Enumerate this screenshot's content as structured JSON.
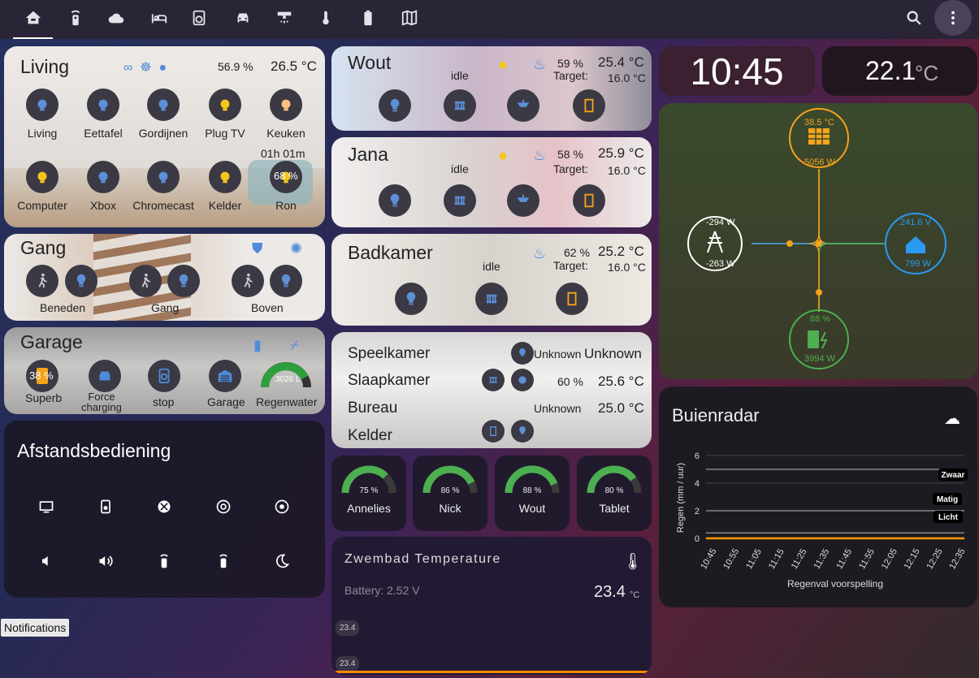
{
  "colors": {
    "accent_blue": "#4f8bdb",
    "solar": "#f5a31b",
    "grid": "#ffffff",
    "home": "#2b9af3",
    "battery": "#4caf50",
    "gauge": "#4caf50",
    "flame": "#4f8bdb",
    "rain_line": "#ff9800"
  },
  "topbar": {
    "icons": [
      "home-icon",
      "remote-icon",
      "cloud-icon",
      "bed-icon",
      "washer-icon",
      "car-icon",
      "shower-icon",
      "thermometer-icon",
      "battery-icon",
      "map-icon"
    ],
    "search_icon": "search-icon",
    "menu_icon": "dots-vertical-icon"
  },
  "living": {
    "title": "Living",
    "humidity": "56.9 %",
    "temp": "26.5 °C",
    "timer": "01h 01m",
    "fan_pct": "68 %",
    "buttons": [
      {
        "label": "Living",
        "icon": "bulb-icon"
      },
      {
        "label": "Eettafel",
        "icon": "bulb-icon"
      },
      {
        "label": "Gordijnen",
        "icon": "curtains-icon"
      },
      {
        "label": "Plug TV",
        "icon": "socket-icon"
      },
      {
        "label": "Keuken",
        "icon": "bulb-icon"
      },
      {
        "label": "Computer",
        "icon": "desktop-icon"
      },
      {
        "label": "Xbox",
        "icon": "xbox-icon"
      },
      {
        "label": "Chromecast",
        "icon": "cast-icon"
      },
      {
        "label": "Kelder",
        "icon": "fan-icon"
      },
      {
        "label": "Ron",
        "icon": "washer-icon"
      }
    ]
  },
  "gang": {
    "title": "Gang",
    "buttons": [
      {
        "label": "Beneden"
      },
      {
        "label": "Gang"
      },
      {
        "label": "Boven"
      }
    ]
  },
  "garage": {
    "title": "Garage",
    "superb_pct": "38 %",
    "rain_tank": "3026 L",
    "buttons": [
      {
        "label": "Superb"
      },
      {
        "label": "Force\ncharging"
      },
      {
        "label": "stop"
      },
      {
        "label": "Garage"
      },
      {
        "label": "Regenwater"
      }
    ]
  },
  "remote": {
    "title": "Afstandsbediening",
    "row1": [
      "tv-icon",
      "speaker-icon",
      "xbox-icon",
      "chrome-icon",
      "record-icon"
    ],
    "row2": [
      "volume-down-icon",
      "volume-up-icon",
      "remote-icon",
      "remote-icon",
      "sleep-icon"
    ]
  },
  "notifications": {
    "label": "Notifications"
  },
  "wout": {
    "title": "Wout",
    "state": "idle",
    "humidity": "59 %",
    "temp": "25.4 °C",
    "target_label": "Target:",
    "target": "16.0 °C"
  },
  "jana": {
    "title": "Jana",
    "state": "idle",
    "humidity": "58 %",
    "temp": "25.9 °C",
    "target_label": "Target:",
    "target": "16.0 °C"
  },
  "badkamer": {
    "title": "Badkamer",
    "state": "idle",
    "humidity": "62 %",
    "temp": "25.2 °C",
    "target_label": "Target:",
    "target": "16.0 °C"
  },
  "rooms": {
    "rows": [
      {
        "name": "Speelkamer",
        "hum": "Unknown",
        "temp": "Unknown"
      },
      {
        "name": "Slaapkamer",
        "hum": "60 %",
        "temp": "25.6 °C"
      },
      {
        "name": "Bureau",
        "hum": "Unknown",
        "temp": "25.0 °C"
      },
      {
        "name": "Kelder",
        "hum": "",
        "temp": ""
      }
    ]
  },
  "gauges": [
    {
      "label": "Annelies",
      "value": "75 %",
      "level": 0.75
    },
    {
      "label": "Nick",
      "value": "86 %",
      "level": 0.86
    },
    {
      "label": "Wout",
      "value": "88 %",
      "level": 0.88
    },
    {
      "label": "Tablet",
      "value": "80 %",
      "level": 0.8
    }
  ],
  "pool": {
    "title": "Zwembad Temperature",
    "battery": "Battery: 2.52 V",
    "temp": "23.4",
    "unit": "°C",
    "chip1": "23.4",
    "chip2": "23.4"
  },
  "clock": {
    "time": "10:45",
    "temp": "22.1",
    "unit": "°C"
  },
  "energy": {
    "solar_temp": "38.5 °C",
    "solar_w": "5056 W",
    "grid_in": "-294 W",
    "grid_out": "-263 W",
    "home_v": "241.6 V",
    "home_w": "799 W",
    "battery_pct": "88 %",
    "battery_w": "3994 W"
  },
  "buienradar": {
    "title": "Buienradar",
    "ylabel": "Regen (mm / uur)",
    "xlabel": "Regenval voorspelling",
    "levels": [
      "Zwaar",
      "Matig",
      "Licht"
    ]
  },
  "chart_data": {
    "type": "line",
    "x": [
      "10:45",
      "10:55",
      "11:05",
      "11:15",
      "11:25",
      "11:35",
      "11:45",
      "11:55",
      "12:05",
      "12:15",
      "12:25",
      "12:35"
    ],
    "series": [
      {
        "values": [
          0,
          0,
          0,
          0,
          0,
          0,
          0,
          0,
          0,
          0,
          0,
          0
        ]
      }
    ],
    "ylim": [
      0,
      6
    ],
    "yticks": [
      0,
      2,
      4,
      6
    ],
    "thresholds": [
      {
        "label": "Zwaar",
        "value": 5
      },
      {
        "label": "Matig",
        "value": 2
      },
      {
        "label": "Licht",
        "value": 0.4
      }
    ],
    "xlabel": "Regenval voorspelling",
    "ylabel": "Regen (mm / uur)",
    "grid": true
  }
}
